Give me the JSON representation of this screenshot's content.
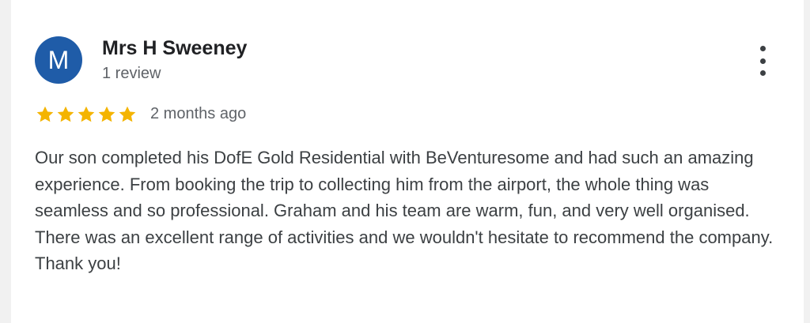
{
  "review": {
    "avatar_initial": "M",
    "reviewer_name": "Mrs H Sweeney",
    "review_count": "1 review",
    "rating": 5,
    "rating_max": 5,
    "time_ago": "2 months ago",
    "text": "Our son completed his DofE Gold Residential with BeVenturesome and had such an amazing experience. From booking the trip to collecting him from the airport, the whole thing was seamless and so professional. Graham and his team are warm, fun, and very well organised. There was an excellent range of activities and we wouldn't hesitate to recommend the company. Thank you!"
  },
  "icons": {
    "star": "star-icon",
    "menu": "more-vert-icon"
  },
  "colors": {
    "avatar_bg": "#1f5ca8",
    "star": "#f4b400",
    "name": "#202124",
    "secondary_text": "#5f6368",
    "body_text": "#3c4043"
  }
}
